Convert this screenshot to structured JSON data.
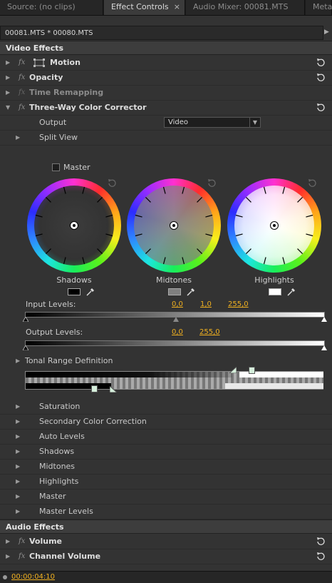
{
  "tabs": [
    {
      "label": "Source: (no clips)",
      "active": false
    },
    {
      "label": "Effect Controls",
      "active": true,
      "close": "×"
    },
    {
      "label": "Audio Mixer: 00081.MTS",
      "active": false
    },
    {
      "label": "Meta",
      "active": false
    }
  ],
  "clip_bar": "00081.MTS * 00080.MTS",
  "video_effects": {
    "header": "Video Effects",
    "items": [
      {
        "label": "Motion",
        "fx": "fx"
      },
      {
        "label": "Opacity",
        "fx": "fx"
      },
      {
        "label": "Time Remapping",
        "fx": "fx"
      },
      {
        "label": "Three-Way Color Corrector",
        "fx": "fx"
      }
    ]
  },
  "corrector": {
    "output_label": "Output",
    "output_value": "Video",
    "split_view": "Split View",
    "master_label": "Master",
    "wheels": [
      "Shadows",
      "Midtones",
      "Highlights"
    ],
    "swatch_colors": [
      "#000000",
      "#7f7f7f",
      "#ffffff"
    ],
    "input_levels_label": "Input Levels:",
    "input_levels": [
      "0,0",
      "1,0",
      "255,0"
    ],
    "output_levels_label": "Output Levels:",
    "output_levels": [
      "0,0",
      "255,0"
    ],
    "tonal_range": "Tonal Range Definition",
    "subitems": [
      "Saturation",
      "Secondary Color Correction",
      "Auto Levels",
      "Shadows",
      "Midtones",
      "Highlights",
      "Master",
      "Master Levels"
    ]
  },
  "audio_effects": {
    "header": "Audio Effects",
    "items": [
      {
        "label": "Volume",
        "fx": "fx"
      },
      {
        "label": "Channel Volume",
        "fx": "fx"
      }
    ]
  },
  "timecode": "00:00:04:10",
  "icons": {
    "reset": "reset-icon",
    "dropper": "eyedropper-icon",
    "motion": "transform-box-icon"
  }
}
